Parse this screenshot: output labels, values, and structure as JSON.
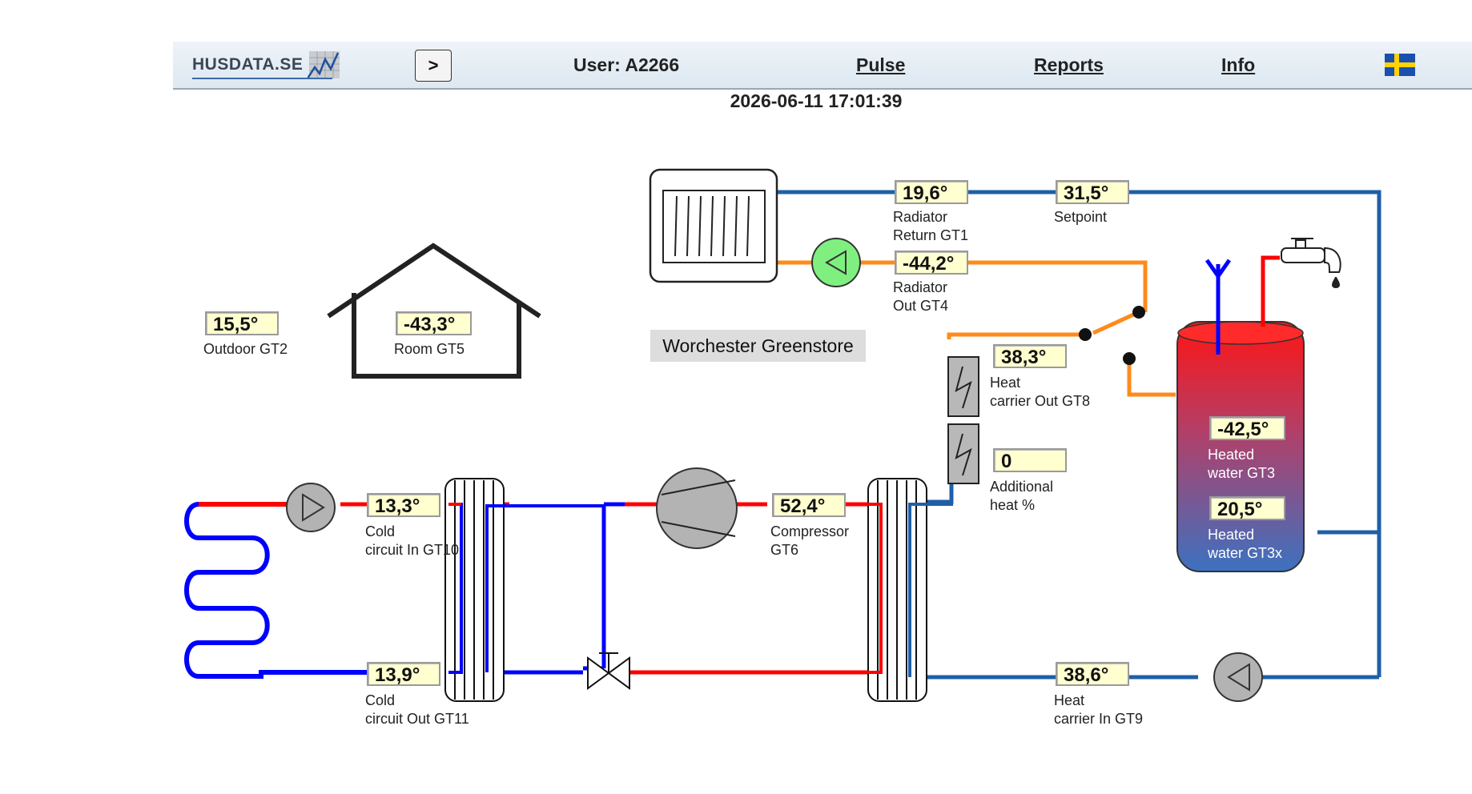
{
  "header": {
    "logo_text": "HUSDATA.SE",
    "menu_button": ">",
    "user": "User: A2266",
    "nav": {
      "pulse": "Pulse",
      "reports": "Reports",
      "info": "Info"
    },
    "flag_icon": "sweden-flag-icon"
  },
  "datetime": "2026-06-11 17:01:39",
  "system_name": "Worchester Greenstore",
  "colors": {
    "hot": "#ff0000",
    "cold": "#0000ff",
    "carrier": "#1f5fa8",
    "radiator_out": "#ff8a1a",
    "value_bg": "#ffffd0"
  },
  "sensors": {
    "radiator_return": {
      "value": "19,6°",
      "label1": "Radiator",
      "label2": "Return GT1"
    },
    "setpoint": {
      "value": "31,5°",
      "label1": "Setpoint"
    },
    "radiator_out": {
      "value": "-44,2°",
      "label1": "Radiator",
      "label2": "Out GT4"
    },
    "outdoor": {
      "value": "15,5°",
      "label1": "Outdoor GT2"
    },
    "room": {
      "value": "-43,3°",
      "label1": "Room GT5"
    },
    "heat_carrier_out": {
      "value": "38,3°",
      "label1": "Heat",
      "label2": "carrier Out GT8"
    },
    "additional_heat": {
      "value": "0",
      "label1": "Additional",
      "label2": "heat %"
    },
    "heated_water_gt3": {
      "value": "-42,5°",
      "label1": "Heated",
      "label2": "water GT3"
    },
    "heated_water_gt3x": {
      "value": "20,5°",
      "label1": "Heated",
      "label2": "water GT3x"
    },
    "cold_in": {
      "value": "13,3°",
      "label1": "Cold",
      "label2": "circuit In GT10"
    },
    "compressor": {
      "value": "52,4°",
      "label1": "Compressor",
      "label2": "GT6"
    },
    "cold_out": {
      "value": "13,9°",
      "label1": "Cold",
      "label2": "circuit Out GT11"
    },
    "heat_carrier_in": {
      "value": "38,6°",
      "label1": "Heat",
      "label2": "carrier In GT9"
    }
  }
}
